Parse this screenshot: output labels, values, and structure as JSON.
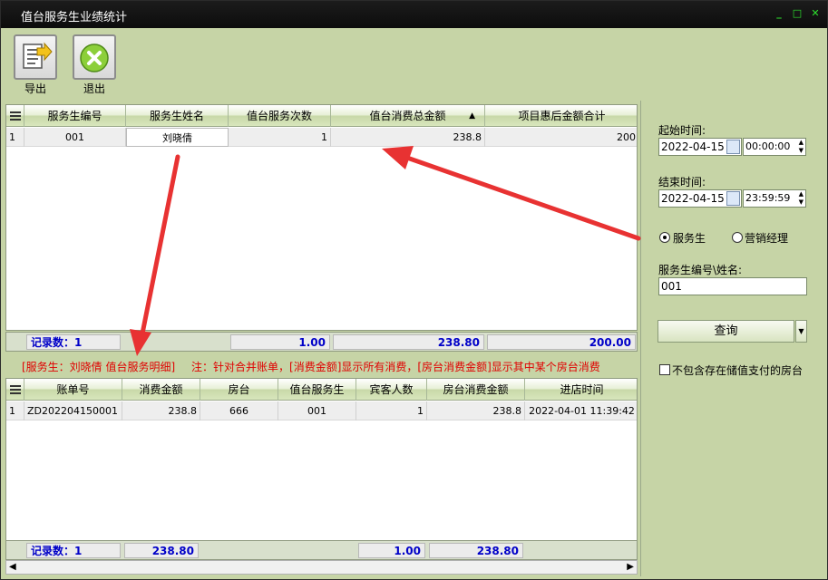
{
  "window": {
    "title": "值台服务生业绩统计"
  },
  "toolbar": {
    "export_label": "导出",
    "exit_label": "退出"
  },
  "top_grid": {
    "columns": [
      "服务生编号",
      "服务生姓名",
      "值台服务次数",
      "值台消费总金额",
      "项目惠后金额合计"
    ],
    "rows": [
      {
        "index": "1",
        "cells": [
          "001",
          "刘晓倩",
          "1",
          "238.8",
          "200"
        ]
      }
    ],
    "summary": {
      "record_label": "记录数：1",
      "count_total": "1.00",
      "amount_total": "238.80",
      "discount_total": "200.00"
    }
  },
  "info_line": {
    "title": "[服务生：刘晓倩 值台服务明细]",
    "note": "注：针对合并账单，[消费金额]显示所有消费，[房台消费金额]显示其中某个房台消费"
  },
  "bottom_grid": {
    "columns": [
      "账单号",
      "消费金额",
      "房台",
      "值台服务生",
      "宾客人数",
      "房台消费金额",
      "进店时间"
    ],
    "rows": [
      {
        "index": "1",
        "cells": [
          "ZD202204150001",
          "238.8",
          "666",
          "001",
          "1",
          "238.8",
          "2022-04-01 11:39:42"
        ]
      }
    ],
    "summary": {
      "record_label": "记录数：1",
      "amount_total": "238.80",
      "guest_total": "1.00",
      "room_amount_total": "238.80"
    }
  },
  "filters": {
    "start_label": "起始时间:",
    "start_date": "2022-04-15",
    "start_time": "00:00:00",
    "end_label": "结束时间:",
    "end_date": "2022-04-15",
    "end_time": "23:59:59",
    "radio_waiter": "服务生",
    "radio_manager": "营销经理",
    "id_label": "服务生编号\\姓名:",
    "id_value": "001",
    "query_label": "查询",
    "exclude_label": "不包含存在储值支付的房台"
  },
  "colors": {
    "accent_red": "#e00000",
    "summary_blue": "#0000c8",
    "panel_green": "#c6d4a6"
  }
}
